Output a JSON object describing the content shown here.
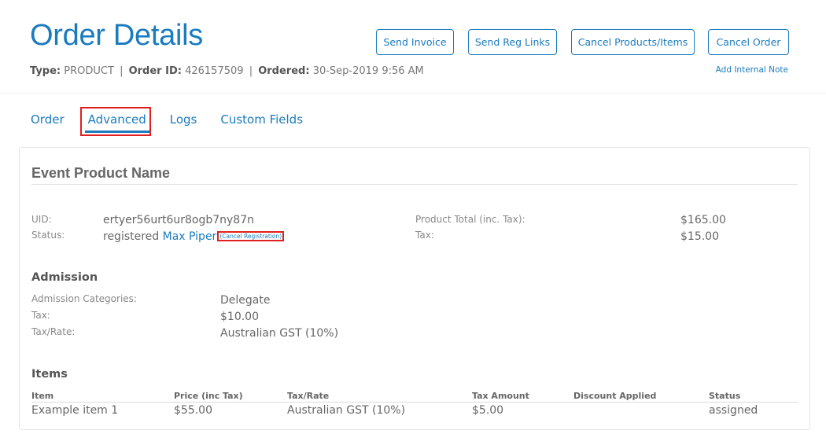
{
  "header": {
    "title": "Order Details",
    "meta": {
      "type_label": "Type:",
      "type_value": "PRODUCT",
      "order_id_label": "Order ID:",
      "order_id_value": "426157509",
      "ordered_label": "Ordered:",
      "ordered_value": "30-Sep-2019 9:56 AM",
      "separator": "|"
    },
    "buttons": {
      "send_invoice": "Send Invoice",
      "send_reg_links": "Send Reg Links",
      "cancel_products": "Cancel Products/Items",
      "cancel_order": "Cancel Order"
    },
    "add_internal_note": "Add Internal Note"
  },
  "tabs": [
    {
      "label": "Order",
      "active": false
    },
    {
      "label": "Advanced",
      "active": true
    },
    {
      "label": "Logs",
      "active": false
    },
    {
      "label": "Custom Fields",
      "active": false
    }
  ],
  "product": {
    "name": "Event Product Name",
    "uid_label": "UID:",
    "uid_value": "ertyer56urt6ur8ogb7ny87n",
    "status_label": "Status:",
    "status_value": "registered",
    "registrant_name": "Max Piper",
    "cancel_registration": "(Cancel Registration)",
    "product_total_label": "Product Total (inc. Tax):",
    "product_total_value": "$165.00",
    "tax_label": "Tax:",
    "tax_value": "$15.00"
  },
  "admission": {
    "heading": "Admission",
    "categories_label": "Admission Categories:",
    "categories_value": "Delegate",
    "tax_label": "Tax:",
    "tax_value": "$10.00",
    "tax_rate_label": "Tax/Rate:",
    "tax_rate_value": "Australian GST (10%)"
  },
  "items": {
    "heading": "Items",
    "columns": [
      "Item",
      "Price (inc Tax)",
      "Tax/Rate",
      "Tax Amount",
      "Discount Applied",
      "Status"
    ],
    "rows": [
      [
        "Example item 1",
        "$55.00",
        "Australian GST (10%)",
        "$5.00",
        "",
        "assigned"
      ]
    ]
  },
  "colors": {
    "accent": "#1a7bbf",
    "highlight": "#e02020"
  }
}
